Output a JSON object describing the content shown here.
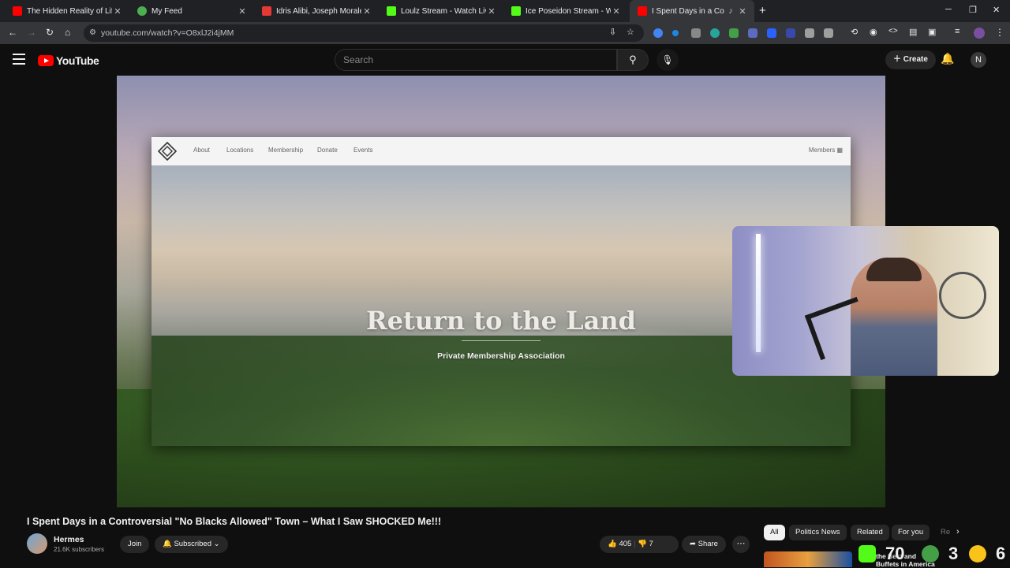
{
  "browser": {
    "tabs": [
      {
        "title": "The Hidden Reality of Life in Pu",
        "favicon_color": "#ff0000"
      },
      {
        "title": "My Feed",
        "favicon_color": "#4caf50"
      },
      {
        "title": "Idris Alibi, Joseph Morales Bett",
        "favicon_color": "#e53935"
      },
      {
        "title": "Loulz Stream - Watch Live on K",
        "favicon_color": "#53fc18"
      },
      {
        "title": "Ice Poseidon Stream - Watch Li",
        "favicon_color": "#53fc18"
      },
      {
        "title": "I Spent Days in a Controve",
        "favicon_color": "#ff0000"
      }
    ],
    "tab_close_glyph": "✕",
    "new_tab_glyph": "+",
    "url": "youtube.com/watch?v=O8xlJ2i4jMM"
  },
  "youtube": {
    "logo_text": "YouTube",
    "search_placeholder": "Search",
    "create_label": "Create",
    "avatar_letter": "N"
  },
  "player": {
    "site_nav": [
      "About",
      "Locations",
      "Membership",
      "Donate",
      "Events"
    ],
    "members_label": "Members",
    "hero_title": "Return to the Land",
    "hero_subtitle": "Private Membership Association"
  },
  "video": {
    "title": "I Spent Days in a Controversial \"No Blacks Allowed\" Town – What I Saw SHOCKED Me!!!",
    "channel_name": "Hermes",
    "subscribers": "21.6K subscribers",
    "join_label": "Join",
    "subscribed_label": "Subscribed",
    "likes": "405",
    "dislikes": "7",
    "share_label": "Share"
  },
  "chips": [
    "All",
    "Politics News",
    "Related",
    "For you",
    "Re"
  ],
  "recommendation": {
    "text_line1": "the Best and",
    "text_line2": "Buffets in America"
  },
  "stream_overlay": {
    "value1": "70",
    "value2": "3",
    "value3": "6"
  },
  "colors": {
    "youtube_red": "#ff0000",
    "kick_green": "#53fc18"
  }
}
